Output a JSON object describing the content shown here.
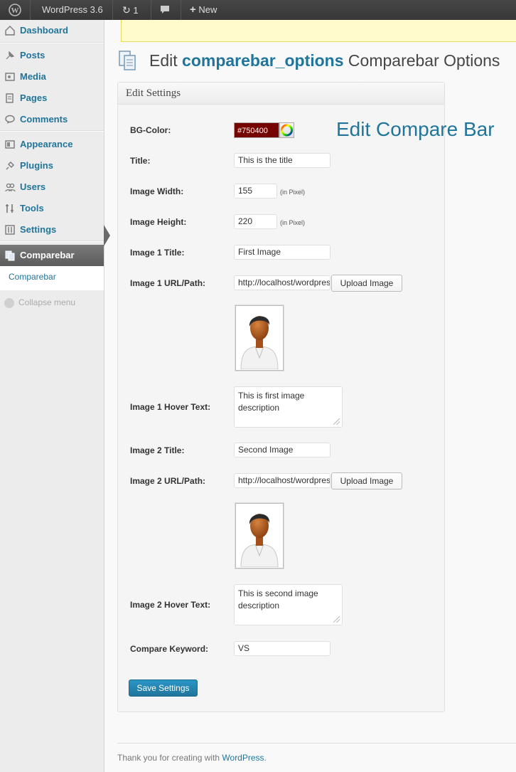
{
  "admin_bar": {
    "wp_logo_icon": "wordpress-logo-icon",
    "site_label": "WordPress 3.6",
    "updates_count": "1",
    "new_label": "New"
  },
  "sidebar": {
    "items": [
      {
        "label": "Dashboard",
        "icon": "dashboard-icon"
      },
      {
        "label": "Posts",
        "icon": "pin-icon"
      },
      {
        "label": "Media",
        "icon": "media-icon"
      },
      {
        "label": "Pages",
        "icon": "pages-icon"
      },
      {
        "label": "Comments",
        "icon": "comment-icon"
      },
      {
        "label": "Appearance",
        "icon": "appearance-icon"
      },
      {
        "label": "Plugins",
        "icon": "plugin-icon"
      },
      {
        "label": "Users",
        "icon": "users-icon"
      },
      {
        "label": "Tools",
        "icon": "tools-icon"
      },
      {
        "label": "Settings",
        "icon": "settings-icon"
      }
    ],
    "current": {
      "label": "Comparebar",
      "icon": "comparebar-icon"
    },
    "submenu": {
      "label": "Comparebar"
    },
    "collapse_label": "Collapse menu"
  },
  "page": {
    "title_prefix": "Edit",
    "title_highlight": "comparebar_options",
    "title_suffix": "Comparebar Options",
    "side_heading": "Edit Compare Bar"
  },
  "panel": {
    "heading": "Edit Settings",
    "fields": {
      "bg_color": {
        "label": "BG-Color:",
        "value": "#750400",
        "color": "#750400"
      },
      "title": {
        "label": "Title:",
        "value": "This is the title"
      },
      "image_width": {
        "label": "Image Width:",
        "value": "155",
        "hint": "(in Pixel)"
      },
      "image_height": {
        "label": "Image Height:",
        "value": "220",
        "hint": "(in Pixel)"
      },
      "image1_title": {
        "label": "Image 1 Title:",
        "value": "First Image"
      },
      "image1_url": {
        "label": "Image 1 URL/Path:",
        "value": "http://localhost/wordpress",
        "upload": "Upload Image"
      },
      "image1_hover": {
        "label": "Image 1 Hover Text:",
        "value": "This is first image description"
      },
      "image2_title": {
        "label": "Image 2 Title:",
        "value": "Second Image"
      },
      "image2_url": {
        "label": "Image 2 URL/Path:",
        "value": "http://localhost/wordpress",
        "upload": "Upload Image"
      },
      "image2_hover": {
        "label": "Image 2 Hover Text:",
        "value": "This is second image description"
      },
      "compare_keyword": {
        "label": "Compare Keyword:",
        "value": "VS"
      }
    },
    "save_label": "Save Settings"
  },
  "footer": {
    "prefix": "Thank you for creating with ",
    "link": "WordPress",
    "suffix": "."
  }
}
